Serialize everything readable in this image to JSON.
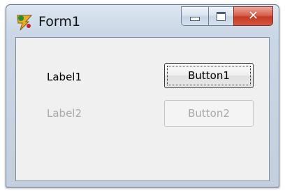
{
  "window": {
    "title": "Form1",
    "icon": "delphi-app-icon",
    "caption_buttons": [
      "minimize",
      "maximize",
      "close"
    ]
  },
  "form": {
    "label1": "Label1",
    "label2": "Label2",
    "button1": "Button1",
    "button2": "Button2",
    "label2_enabled": false,
    "button2_enabled": false
  },
  "colors": {
    "titlebar": "#cbd7e6",
    "client": "#f0f0f0",
    "close_button": "#c53a23",
    "disabled_text": "#a9a9a9"
  }
}
